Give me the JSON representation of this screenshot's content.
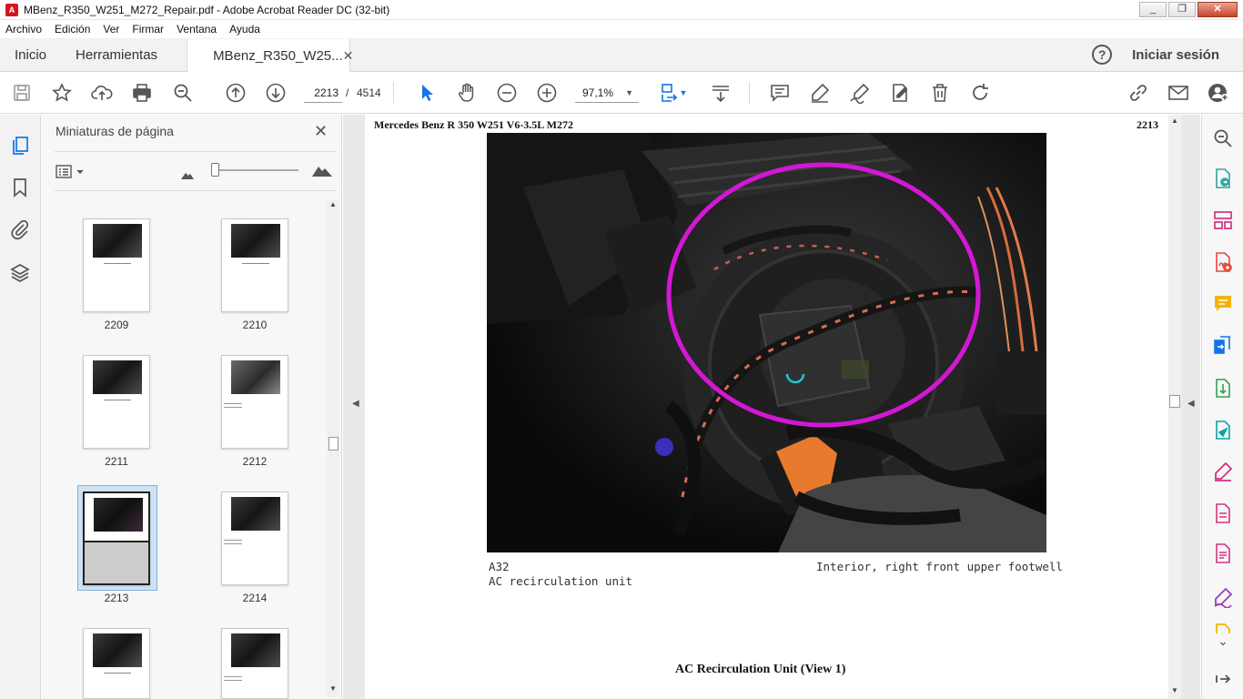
{
  "window": {
    "title": "MBenz_R350_W251_M272_Repair.pdf - Adobe Acrobat Reader DC (32-bit)",
    "app_icon": "pdf-icon",
    "controls": [
      "_",
      "❐",
      "✕"
    ]
  },
  "menu": [
    "Archivo",
    "Edición",
    "Ver",
    "Firmar",
    "Ventana",
    "Ayuda"
  ],
  "tabs": {
    "home": "Inicio",
    "tools": "Herramientas",
    "document": "MBenz_R350_W25...",
    "close": "✕",
    "help": "?",
    "signin": "Iniciar sesión"
  },
  "toolbar": {
    "page_current": "2213",
    "page_separator": "/",
    "page_total": "4514",
    "zoom": "97,1%",
    "icons": [
      "save-icon",
      "star-icon",
      "upload-icon",
      "print-icon",
      "zoom-search-icon",
      "page-up-icon",
      "page-down-icon",
      "select-arrow-icon",
      "hand-tool-icon",
      "zoom-out-icon",
      "zoom-in-icon",
      "fit-page-icon",
      "scroll-mode-icon",
      "comment-icon",
      "highlight-icon",
      "sign-icon",
      "edit-stamp-icon",
      "delete-icon",
      "rotate-icon",
      "link-icon",
      "email-icon",
      "add-user-icon"
    ]
  },
  "thumbnails": {
    "title": "Miniaturas de página",
    "close": "✕",
    "pages": [
      {
        "num": "2209",
        "selected": false
      },
      {
        "num": "2210",
        "selected": false
      },
      {
        "num": "2211",
        "selected": false
      },
      {
        "num": "2212",
        "selected": false
      },
      {
        "num": "2213",
        "selected": true
      },
      {
        "num": "2214",
        "selected": false
      }
    ]
  },
  "document": {
    "header_left": "Mercedes Benz R 350 W251 V6-3.5L M272",
    "header_right": "2213",
    "caption_code": "A32",
    "caption_label": "AC recirculation unit",
    "caption_location": "Interior, right front upper footwell",
    "page_title": "AC Recirculation Unit (View 1)",
    "highlight_color": "#d417d4"
  },
  "colors": {
    "accent_blue": "#1473e6",
    "tool_green": "#2ea44f",
    "tool_red": "#e8483c",
    "tool_yellow": "#f4b400",
    "tool_purple": "#9b3dbd",
    "tool_pink": "#d6327f",
    "tool_teal": "#0fa3a3"
  }
}
